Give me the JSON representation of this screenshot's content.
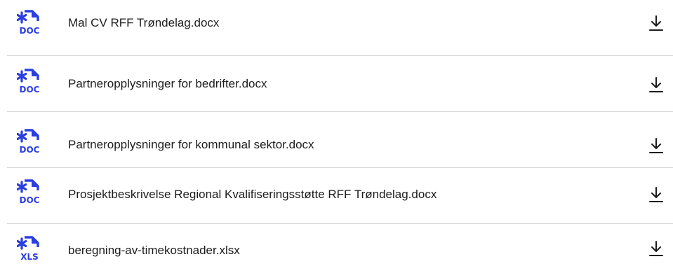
{
  "colors": {
    "icon_accent": "#2b3ee0",
    "text": "#1c1c1c",
    "divider": "#d7d7d7"
  },
  "files": [
    {
      "name": "Mal CV RFF Trøndelag.docx",
      "type_label": "DOC",
      "icon": "doc-file-icon",
      "action_icon": "download-icon"
    },
    {
      "name": "Partneropplysninger for bedrifter.docx",
      "type_label": "DOC",
      "icon": "doc-file-icon",
      "action_icon": "download-icon"
    },
    {
      "name": "Partneropplysninger for kommunal sektor.docx",
      "type_label": "DOC",
      "icon": "doc-file-icon",
      "action_icon": "download-icon"
    },
    {
      "name": "Prosjektbeskrivelse Regional Kvalifiseringsstøtte RFF Trøndelag.docx",
      "type_label": "DOC",
      "icon": "doc-file-icon",
      "action_icon": "download-icon"
    },
    {
      "name": "beregning-av-timekostnader.xlsx",
      "type_label": "XLS",
      "icon": "xls-file-icon",
      "action_icon": "download-icon"
    }
  ]
}
